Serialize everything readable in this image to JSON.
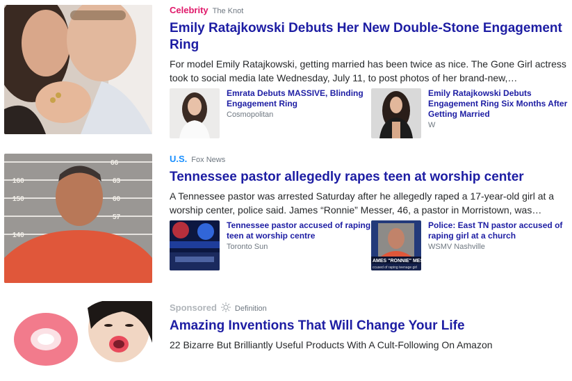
{
  "stories": [
    {
      "category": "Celebrity",
      "category_color": "#e0196a",
      "source": "The Knot",
      "headline": "Emily Ratajkowski Debuts Her New Double-Stone Engagement Ring",
      "summary": "For model Emily Ratajkowski, getting married has been twice as nice. The Gone Girl actress took to social media late Wednesday, July 11, to post photos of her brand-new,…",
      "thumbnail_icon": "couple-photo",
      "related": [
        {
          "title": "Emrata Debuts MASSIVE, Blinding Engagement Ring",
          "source": "Cosmopolitan",
          "thumbnail_icon": "woman-photo"
        },
        {
          "title": "Emily Ratajkowski Debuts Engagement Ring Six Months After Getting Married",
          "source": "W",
          "thumbnail_icon": "woman-dark-photo"
        }
      ]
    },
    {
      "category": "U.S.",
      "category_color": "#188fff",
      "source": "Fox News",
      "headline": "Tennessee pastor allegedly rapes teen at worship center",
      "summary": "A Tennessee pastor was arrested Saturday after he allegedly raped a 17-year-old girl at a worship center, police said. James “Ronnie” Messer, 46, a pastor in Morristown, was…",
      "thumbnail_icon": "mugshot-photo",
      "mugshot_marks": [
        "66",
        "160",
        "63",
        "150",
        "60",
        "57",
        "140"
      ],
      "related": [
        {
          "title": "Tennessee pastor accused of raping teen at worship centre",
          "source": "Toronto Sun",
          "thumbnail_icon": "police-lights-photo"
        },
        {
          "title": "Police: East TN pastor accused of raping girl at a church",
          "source": "WSMV Nashville",
          "thumbnail_icon": "news-mugshot-photo",
          "caption_line1": "AMES \"RONNIE\" MES",
          "caption_line2": "ccused of raping teenage girl"
        }
      ]
    }
  ],
  "sponsored": {
    "label": "Sponsored",
    "source": "Definition",
    "headline": "Amazing Inventions That Will Change Your Life",
    "summary": "22 Bizarre But Brilliantly Useful Products With A Cult-Following On Amazon",
    "thumbnail_icon": "lips-photo"
  }
}
